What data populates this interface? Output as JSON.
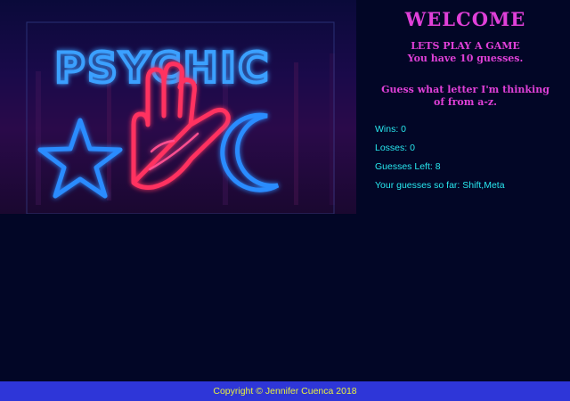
{
  "hero": {
    "sign_text": "PSYCHIC",
    "icons": [
      "star-icon",
      "palm-hand-icon",
      "crescent-moon-icon"
    ],
    "colors": {
      "neon_blue": "#2a8cff",
      "neon_pink": "#ff2a6a"
    }
  },
  "game": {
    "welcome": "WELCOME",
    "title": "LETS PLAY A GAME",
    "subtitle": "You have 10 guesses.",
    "prompt_line1": "Guess what letter I'm thinking",
    "prompt_line2": "of from a-z.",
    "wins_label": "Wins: ",
    "wins": "0",
    "losses_label": "Losses: ",
    "losses": "0",
    "guesses_left_label": "Guesses Left: ",
    "guesses_left": "8",
    "guesses_so_far_label": "Your guesses so far: ",
    "guesses_so_far": "Shift,Meta"
  },
  "footer": {
    "copyright": "Copyright © Jennifer Cuenca 2018"
  },
  "colors": {
    "background": "#020626",
    "heading": "#e040d8",
    "stats": "#28e8f0",
    "footer_bg": "#2e36d8",
    "footer_text": "#e8f040"
  }
}
